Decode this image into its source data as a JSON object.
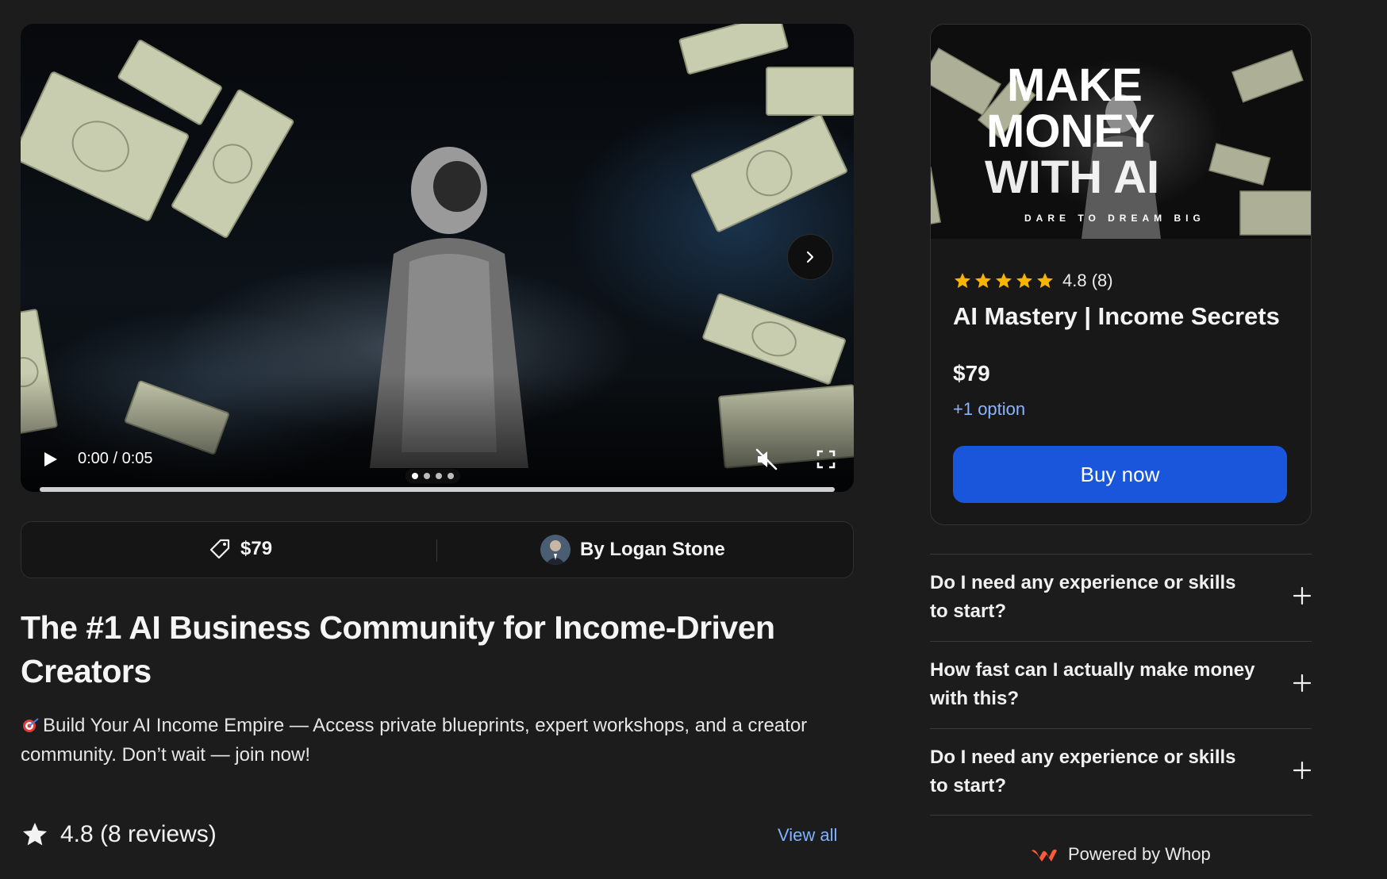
{
  "video": {
    "time": "0:00 / 0:05",
    "slide_count": 4,
    "active_slide": 1,
    "progress_fraction": 0.0
  },
  "info_bar": {
    "price": "$79",
    "author": "By Logan Stone"
  },
  "product": {
    "title": "The #1 AI Business Community for Income-Driven Creators",
    "description": "Build Your AI Income Empire — Access private blueprints, expert workshops, and a creator community. Don’t wait — join now!",
    "description_emoji": "dart-emoji"
  },
  "reviews": {
    "summary": "4.8 (8 reviews)",
    "view_all_label": "View all"
  },
  "card": {
    "cover_line1": "MAKE",
    "cover_line2": "MONEY",
    "cover_line3": "WITH AI",
    "cover_tagline": "DARE TO DREAM BIG",
    "rating_text": "4.8 (8)",
    "stars": 5,
    "title": "AI Mastery | Income Secrets",
    "price": "$79",
    "option_label": "+1 option",
    "buy_label": "Buy now"
  },
  "faq": [
    {
      "question": "Do I need any experience or skills to start?"
    },
    {
      "question": "How fast can I actually make money with this?"
    },
    {
      "question": "Do I need any experience or skills to start?"
    }
  ],
  "footer": {
    "powered_by": "Powered by Whop"
  },
  "colors": {
    "background": "#1c1c1c",
    "accent": "#1a56db",
    "link": "#7fb2ff",
    "star": "#f5b500",
    "whop_logo": "#ff5a36"
  }
}
